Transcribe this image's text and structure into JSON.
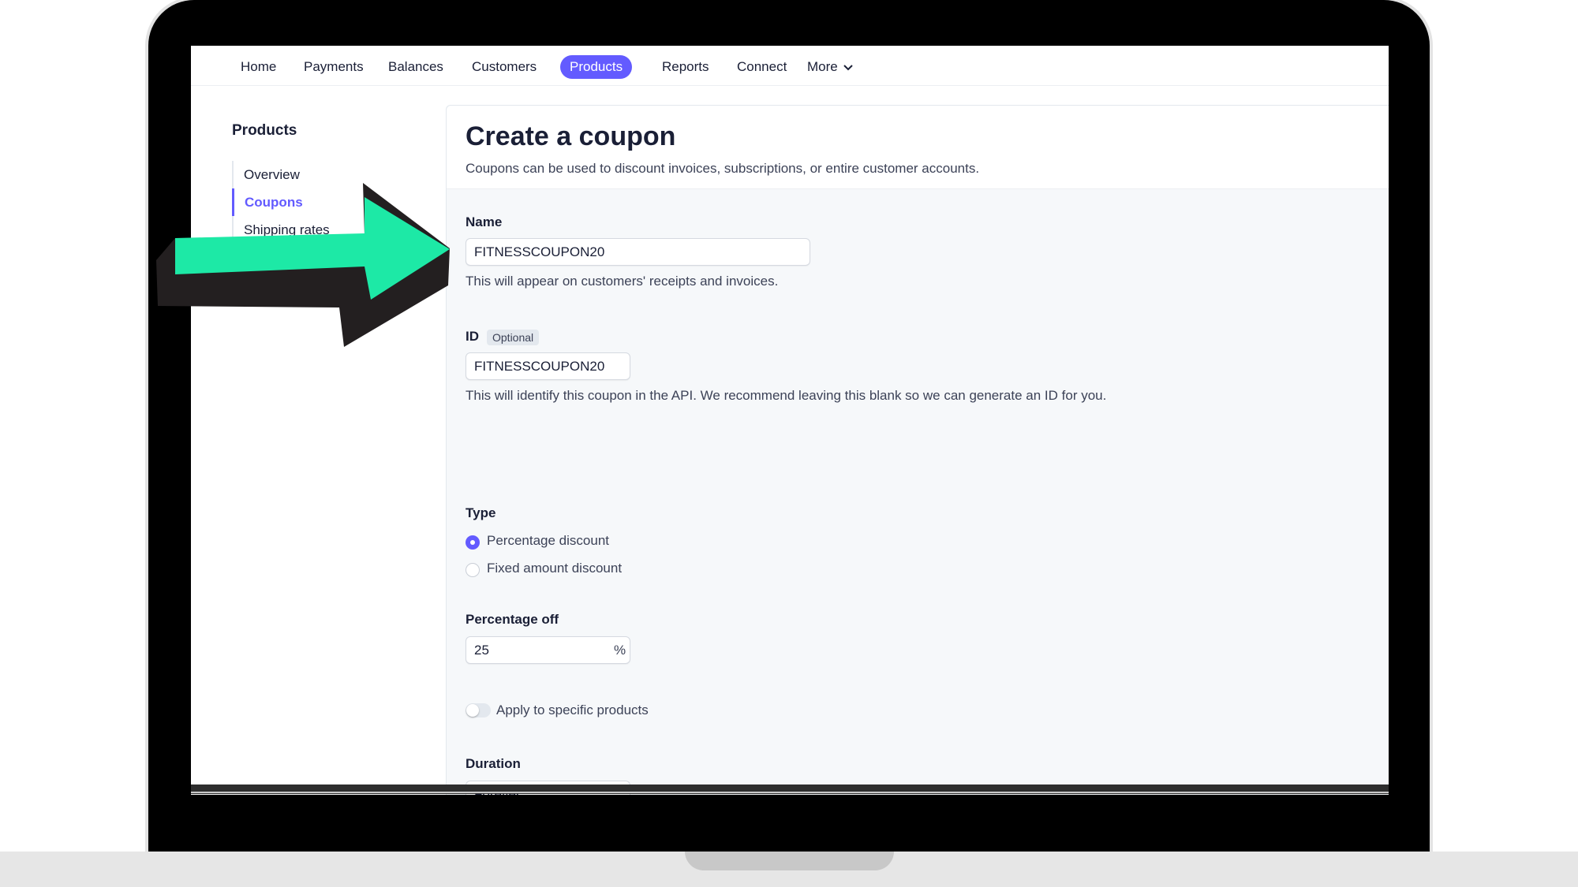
{
  "nav": {
    "items": [
      {
        "label": "Home"
      },
      {
        "label": "Payments"
      },
      {
        "label": "Balances"
      },
      {
        "label": "Customers"
      },
      {
        "label": "Products"
      },
      {
        "label": "Reports"
      },
      {
        "label": "Connect"
      },
      {
        "label": "More"
      }
    ],
    "active": "Products"
  },
  "sidebar": {
    "title": "Products",
    "items": [
      {
        "label": "Overview"
      },
      {
        "label": "Coupons"
      },
      {
        "label": "Shipping rates"
      }
    ],
    "active": "Coupons"
  },
  "page": {
    "title": "Create a coupon",
    "subtitle": "Coupons can be used to discount invoices, subscriptions, or entire customer accounts."
  },
  "form": {
    "name": {
      "label": "Name",
      "value": "FITNESSCOUPON20",
      "help": "This will appear on customers' receipts and invoices."
    },
    "id": {
      "label": "ID",
      "badge": "Optional",
      "value": "FITNESSCOUPON20",
      "help": "This will identify this coupon in the API. We recommend leaving this blank so we can generate an ID for you."
    },
    "type": {
      "label": "Type",
      "options": [
        {
          "label": "Percentage discount",
          "selected": true
        },
        {
          "label": "Fixed amount discount",
          "selected": false
        }
      ]
    },
    "percentage": {
      "label": "Percentage off",
      "value": "25",
      "suffix": "%"
    },
    "apply_products": {
      "label": "Apply to specific products",
      "enabled": false
    },
    "duration": {
      "label": "Duration",
      "value": "Forever"
    }
  },
  "colors": {
    "accent": "#635bff",
    "arrow_fill": "#1de9a6",
    "arrow_outline": "#231f20"
  },
  "icons": {
    "more_chevron": "chevron-down-icon",
    "select_caret": "select-updown-icon",
    "annotation": "arrow-right-icon"
  }
}
